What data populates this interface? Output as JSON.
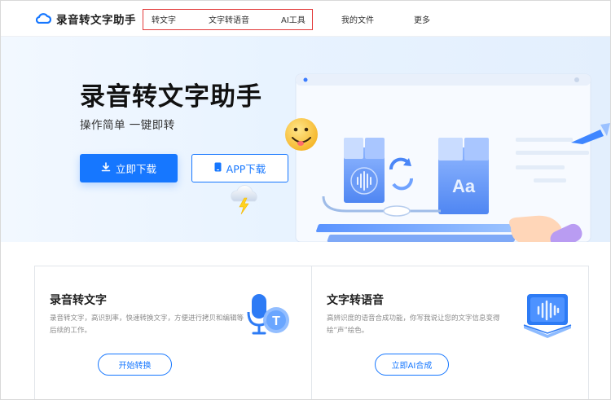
{
  "brand": {
    "name": "录音转文字助手",
    "color": "#1677ff"
  },
  "nav": {
    "items": [
      {
        "label": "转文字"
      },
      {
        "label": "文字转语音"
      },
      {
        "label": "AI工具"
      },
      {
        "label": "我的文件"
      },
      {
        "label": "更多"
      }
    ],
    "highlight_color": "#e23a3a"
  },
  "hero": {
    "title": "录音转文字助手",
    "subtitle": "操作简单 一键即转",
    "download_label": "立即下载",
    "app_label": "APP下载",
    "illustration_text": "Aa"
  },
  "cards": [
    {
      "title": "录音转文字",
      "desc": "录音转文字，高识别率，快速转换文字，方便进行拷贝和编辑等后续的工作。",
      "button": "开始转换",
      "icon": "microphone-text-icon"
    },
    {
      "title": "文字转语音",
      "desc": "高辨识度的语音合成功能，你写我说让您的文字信息变得绘“声”绘色。",
      "button": "立即AI合成",
      "icon": "book-audio-icon"
    }
  ]
}
